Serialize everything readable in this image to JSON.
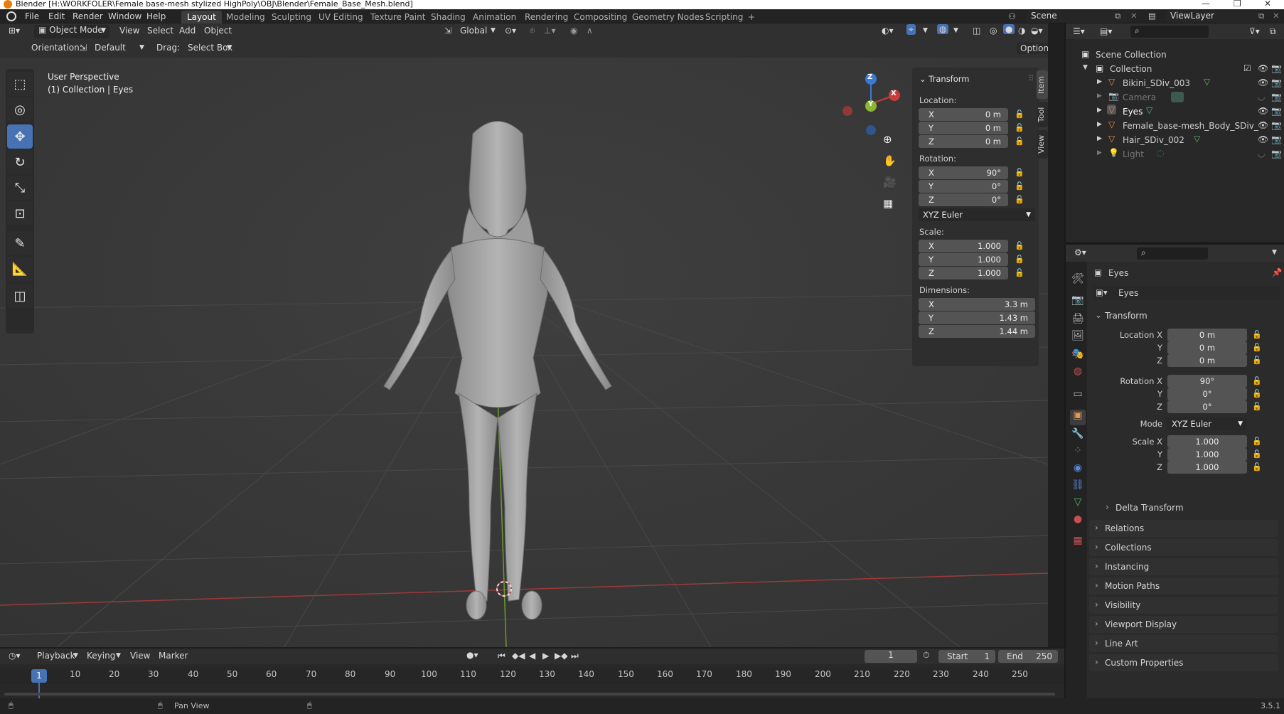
{
  "window": {
    "title": "Blender [H:\\WORKFOLER\\Female base-mesh stylized HighPoly\\OBJ\\Blender\\Female_Base_Mesh.blend]"
  },
  "menu": [
    "File",
    "Edit",
    "Render",
    "Window",
    "Help"
  ],
  "workspaces": [
    "Layout",
    "Modeling",
    "Sculpting",
    "UV Editing",
    "Texture Paint",
    "Shading",
    "Animation",
    "Rendering",
    "Compositing",
    "Geometry Nodes",
    "Scripting"
  ],
  "add_workspace": "+",
  "scene": {
    "name": "Scene",
    "view_layer": "ViewLayer"
  },
  "viewport_header": {
    "mode": "Object Mode",
    "menus": [
      "View",
      "Select",
      "Add",
      "Object"
    ],
    "transform_orientation": "Global"
  },
  "tool_settings": {
    "orientation_label": "Orientation:",
    "orientation_value": "Default",
    "drag_label": "Drag:",
    "drag_value": "Select Box",
    "options": "Options"
  },
  "viewport": {
    "perspective": "User Perspective",
    "context": "(1) Collection | Eyes"
  },
  "gizmo": {
    "x": "X",
    "y": "Y",
    "z": "Z"
  },
  "npanel": {
    "section": "Transform",
    "location_label": "Location:",
    "location": {
      "x": "0 m",
      "y": "0 m",
      "z": "0 m"
    },
    "rotation_label": "Rotation:",
    "rotation": {
      "x": "90°",
      "y": "0°",
      "z": "0°"
    },
    "rotation_mode": "XYZ Euler",
    "scale_label": "Scale:",
    "scale": {
      "x": "1.000",
      "y": "1.000",
      "z": "1.000"
    },
    "dimensions_label": "Dimensions:",
    "dimensions": {
      "x": "3.3 m",
      "y": "1.43 m",
      "z": "1.44 m"
    },
    "axes": {
      "x": "X",
      "y": "Y",
      "z": "Z"
    },
    "tabs": [
      "Item",
      "Tool",
      "View"
    ]
  },
  "outliner": {
    "root": "Scene Collection",
    "collection": "Collection",
    "items": [
      {
        "name": "Bikini_SDiv_003",
        "dim": false
      },
      {
        "name": "Camera",
        "dim": true
      },
      {
        "name": "Eyes",
        "dim": false
      },
      {
        "name": "Female_base-mesh_Body_SDiv_",
        "dim": false
      },
      {
        "name": "Hair_SDiv_002",
        "dim": false
      },
      {
        "name": "Light",
        "dim": true
      }
    ]
  },
  "properties": {
    "object_name": "Eyes",
    "data_name": "Eyes",
    "transform_label": "Transform",
    "labels": {
      "loc_x": "Location X",
      "y": "Y",
      "z": "Z",
      "rot_x": "Rotation X",
      "mode": "Mode",
      "scale_x": "Scale X"
    },
    "location": {
      "x": "0 m",
      "y": "0 m",
      "z": "0 m"
    },
    "rotation": {
      "x": "90°",
      "y": "0°",
      "z": "0°"
    },
    "mode": "XYZ Euler",
    "scale": {
      "x": "1.000",
      "y": "1.000",
      "z": "1.000"
    },
    "delta": "Delta Transform",
    "sections": [
      "Relations",
      "Collections",
      "Instancing",
      "Motion Paths",
      "Visibility",
      "Viewport Display",
      "Line Art",
      "Custom Properties"
    ]
  },
  "timeline": {
    "menus": [
      "Playback",
      "Keying",
      "View",
      "Marker"
    ],
    "current_frame": "1",
    "start_label": "Start",
    "start": "1",
    "end_label": "End",
    "end": "250",
    "ticks": [
      "1",
      "10",
      "20",
      "30",
      "40",
      "50",
      "60",
      "70",
      "80",
      "90",
      "100",
      "110",
      "120",
      "130",
      "140",
      "150",
      "160",
      "170",
      "180",
      "190",
      "200",
      "210",
      "220",
      "230",
      "240",
      "250"
    ]
  },
  "statusbar": {
    "hint": "Pan View",
    "version": "3.5.1"
  },
  "colors": {
    "accent": "#4772b3",
    "x_axis": "#c83c3c",
    "y_axis": "#8ab834",
    "z_axis": "#3a7ad6",
    "selection": "#334d80"
  }
}
